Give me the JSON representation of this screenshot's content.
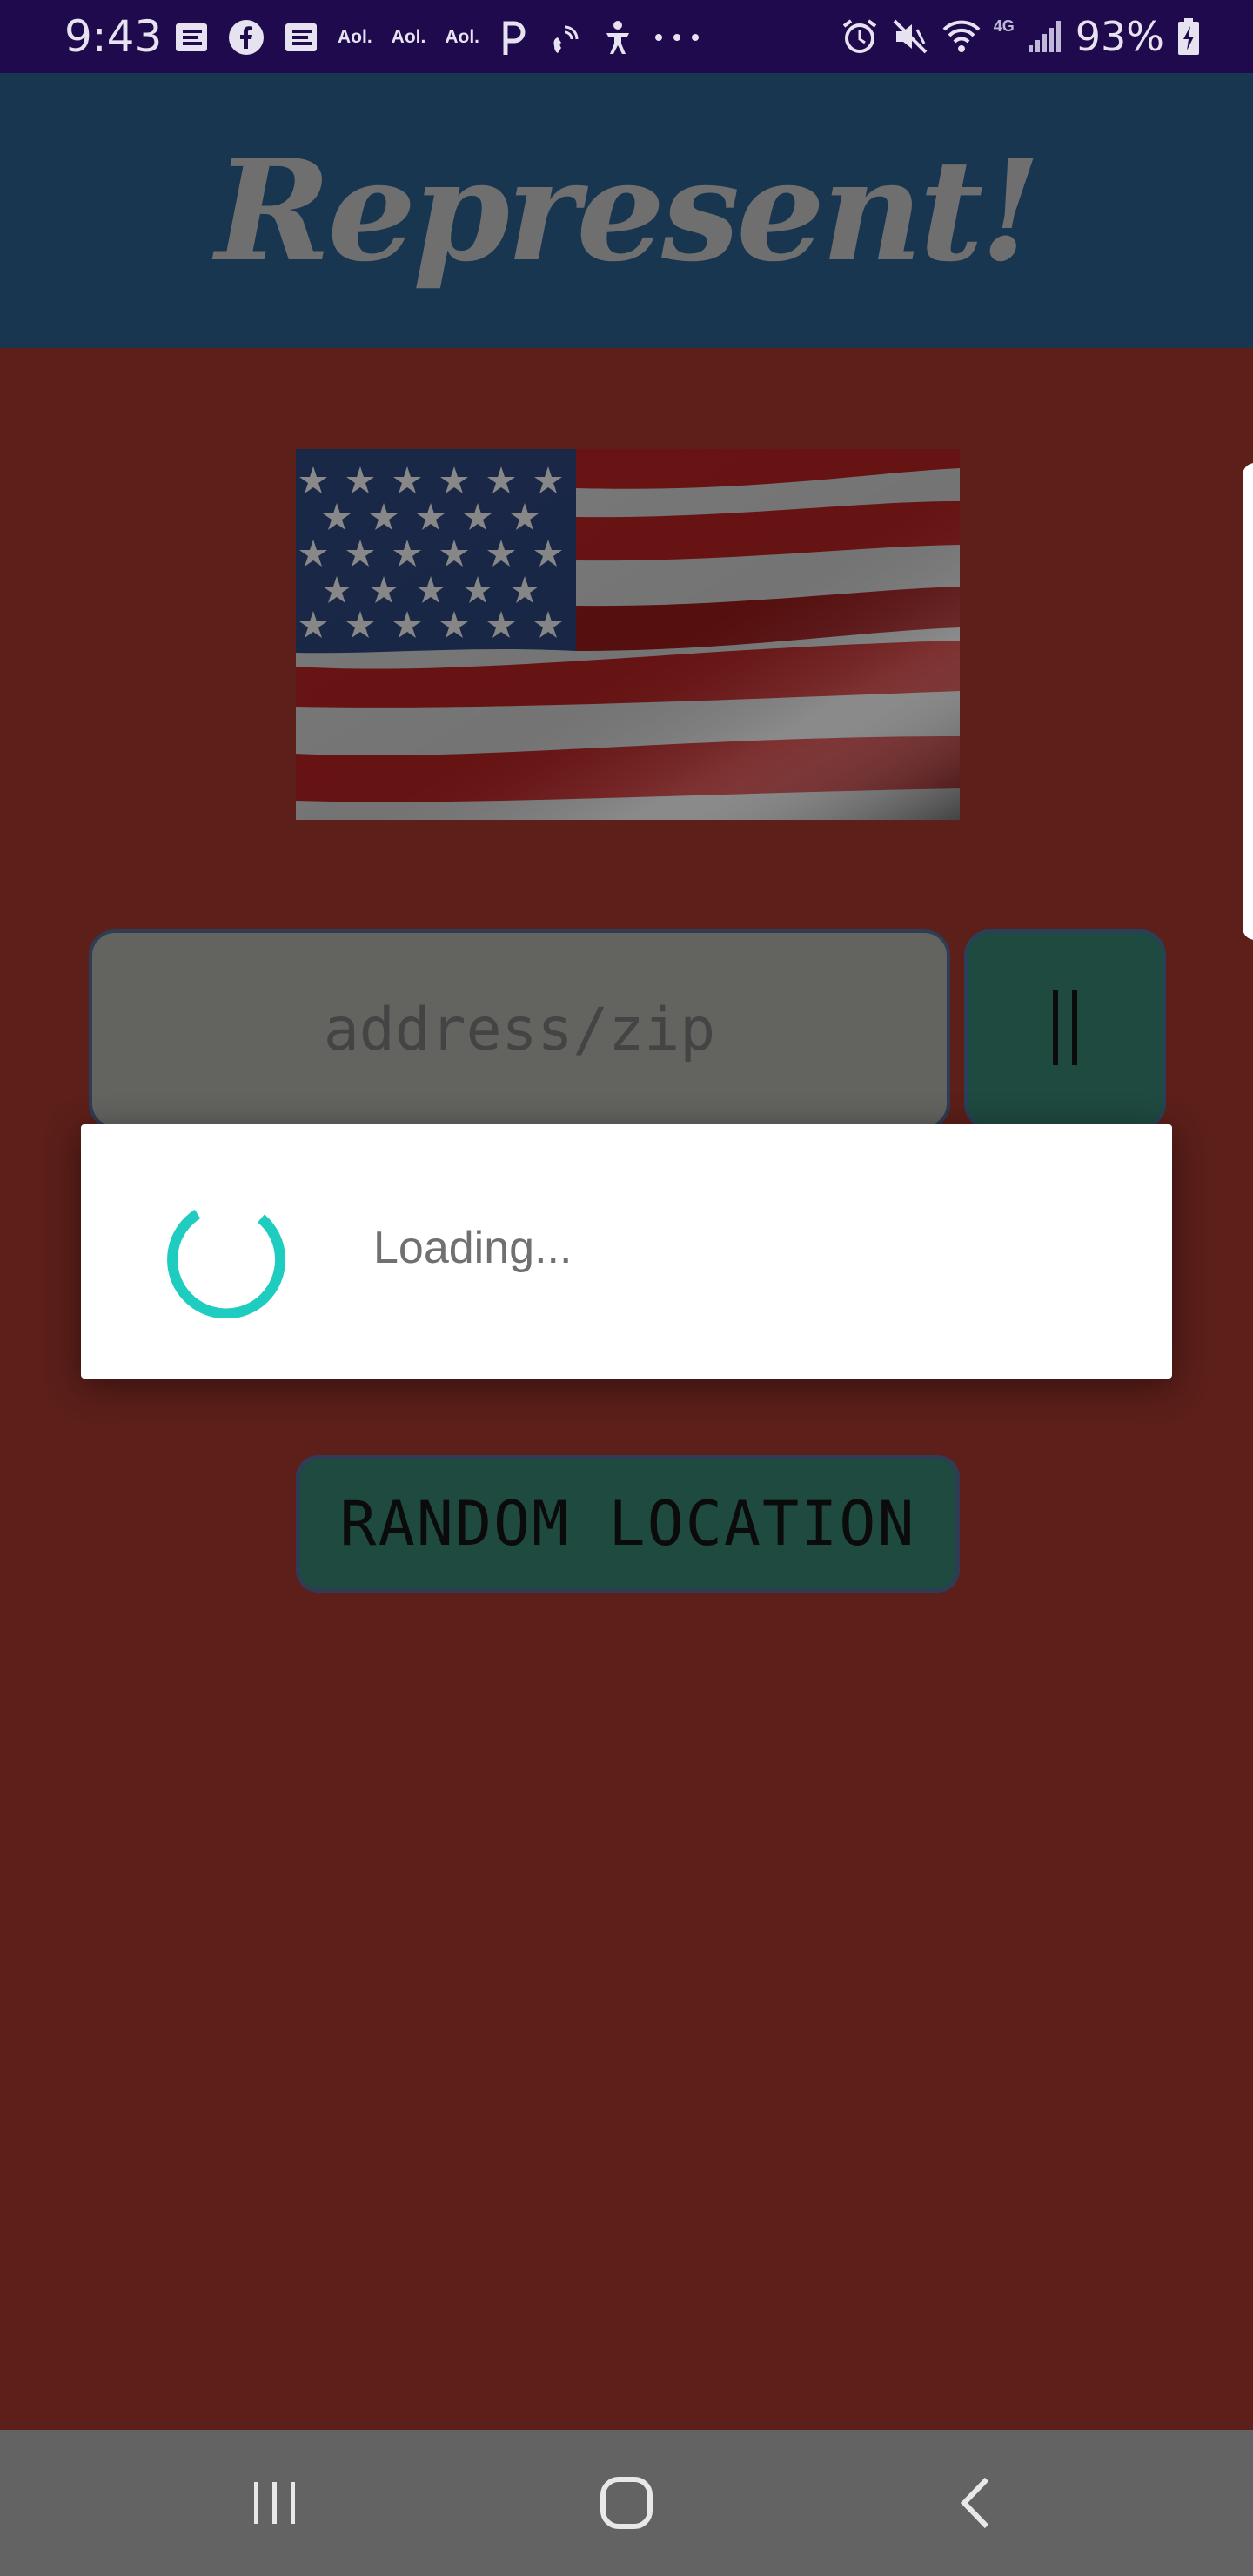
{
  "status_bar": {
    "time": "9:43",
    "left_icons": [
      "notification-e-icon",
      "facebook-icon",
      "notification-e-icon",
      "aol-icon",
      "aol-icon",
      "aol-icon",
      "p-icon",
      "wifi-call-icon",
      "accessibility-icon",
      "more-dots-icon"
    ],
    "aol_label": "Aol.",
    "right_icons": [
      "alarm-icon",
      "mute-icon",
      "wifi-icon",
      "lte-icon",
      "signal-icon",
      "battery-charging-icon"
    ],
    "network_label": "4G",
    "battery": "93%"
  },
  "app": {
    "title": "Represent!"
  },
  "search": {
    "placeholder": "address/zip",
    "go_button_icon": "pause-bars-icon"
  },
  "random_button": {
    "label": "RANDOM LOCATION"
  },
  "dialog": {
    "message": "Loading...",
    "spinner_color": "#1ecdc0"
  },
  "nav": {
    "buttons": [
      "recent-apps-icon",
      "home-icon",
      "back-icon"
    ]
  },
  "colors": {
    "status_bar": "#1e0a4c",
    "app_bar": "#193650",
    "background": "#5c1f19",
    "button_fill": "#1f4a40",
    "input_fill": "#636460"
  }
}
